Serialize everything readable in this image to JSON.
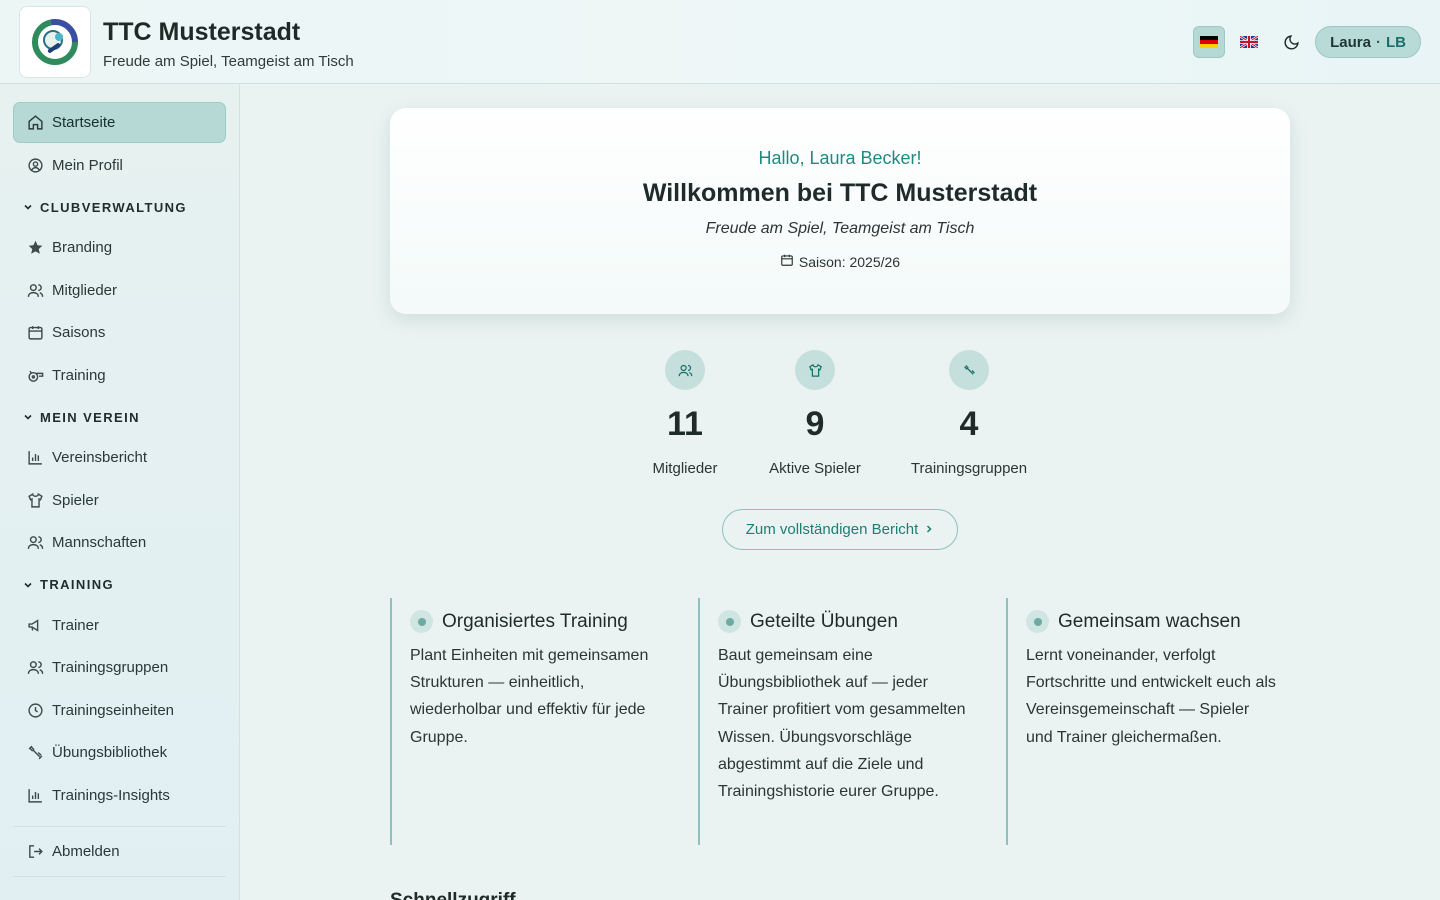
{
  "header": {
    "club_name": "TTC Musterstadt",
    "motto": "Freude am Spiel, Teamgeist am Tisch",
    "languages": [
      {
        "code": "de",
        "label": "Deutsch",
        "active": true
      },
      {
        "code": "en",
        "label": "English",
        "active": false
      }
    ],
    "theme_icon": "moon-icon",
    "user": {
      "name": "Laura",
      "separator": "·",
      "initials": "LB"
    }
  },
  "sidebar": {
    "top_items": [
      {
        "label": "Startseite",
        "icon": "home-icon",
        "active": true
      },
      {
        "label": "Mein Profil",
        "icon": "user-circle-icon",
        "active": false
      }
    ],
    "sections": [
      {
        "title": "CLUBVERWALTUNG",
        "items": [
          {
            "label": "Branding",
            "icon": "star-icon"
          },
          {
            "label": "Mitglieder",
            "icon": "users-icon"
          },
          {
            "label": "Saisons",
            "icon": "calendar-icon"
          },
          {
            "label": "Training",
            "icon": "whistle-icon"
          }
        ]
      },
      {
        "title": "MEIN VEREIN",
        "items": [
          {
            "label": "Vereinsbericht",
            "icon": "bar-chart-icon"
          },
          {
            "label": "Spieler",
            "icon": "shirt-icon"
          },
          {
            "label": "Mannschaften",
            "icon": "users-icon"
          }
        ]
      },
      {
        "title": "TRAINING",
        "items": [
          {
            "label": "Trainer",
            "icon": "megaphone-icon"
          },
          {
            "label": "Trainingsgruppen",
            "icon": "users-icon"
          },
          {
            "label": "Trainingseinheiten",
            "icon": "clock-icon"
          },
          {
            "label": "Übungsbibliothek",
            "icon": "dumbbell-icon"
          },
          {
            "label": "Trainings-Insights",
            "icon": "bar-chart-icon"
          }
        ]
      }
    ],
    "logout": {
      "label": "Abmelden",
      "icon": "logout-icon"
    }
  },
  "welcome": {
    "greeting": "Hallo, Laura Becker!",
    "title": "Willkommen bei TTC Musterstadt",
    "motto": "Freude am Spiel, Teamgeist am Tisch",
    "season": "Saison: 2025/26"
  },
  "stats": [
    {
      "value": "11",
      "label": "Mitglieder",
      "icon": "users-icon"
    },
    {
      "value": "9",
      "label": "Aktive Spieler",
      "icon": "shirt-icon"
    },
    {
      "value": "4",
      "label": "Trainingsgruppen",
      "icon": "dumbbell-icon"
    }
  ],
  "report_button": {
    "label": "Zum vollständigen Bericht"
  },
  "features": [
    {
      "title": "Organisiertes Training",
      "text": "Plant Einheiten mit gemeinsamen Strukturen — einheitlich, wiederholbar und effektiv für jede Gruppe."
    },
    {
      "title": "Geteilte Übungen",
      "text": "Baut gemeinsam eine Übungsbibliothek auf — jeder Trainer profitiert vom gesammelten Wissen. Übungsvorschläge abgestimmt auf die Ziele und Trainingshistorie eurer Gruppe."
    },
    {
      "title": "Gemeinsam wachsen",
      "text": "Lernt voneinander, verfolgt Fortschritte und entwickelt euch als Vereinsgemeinschaft — Spieler und Trainer gleichermaßen."
    }
  ],
  "quick_access": {
    "title": "Schnellzugriff"
  },
  "colors": {
    "accent": "#1f8a80",
    "active_bg": "#b7d9d6",
    "background": "#eaf3f1"
  }
}
